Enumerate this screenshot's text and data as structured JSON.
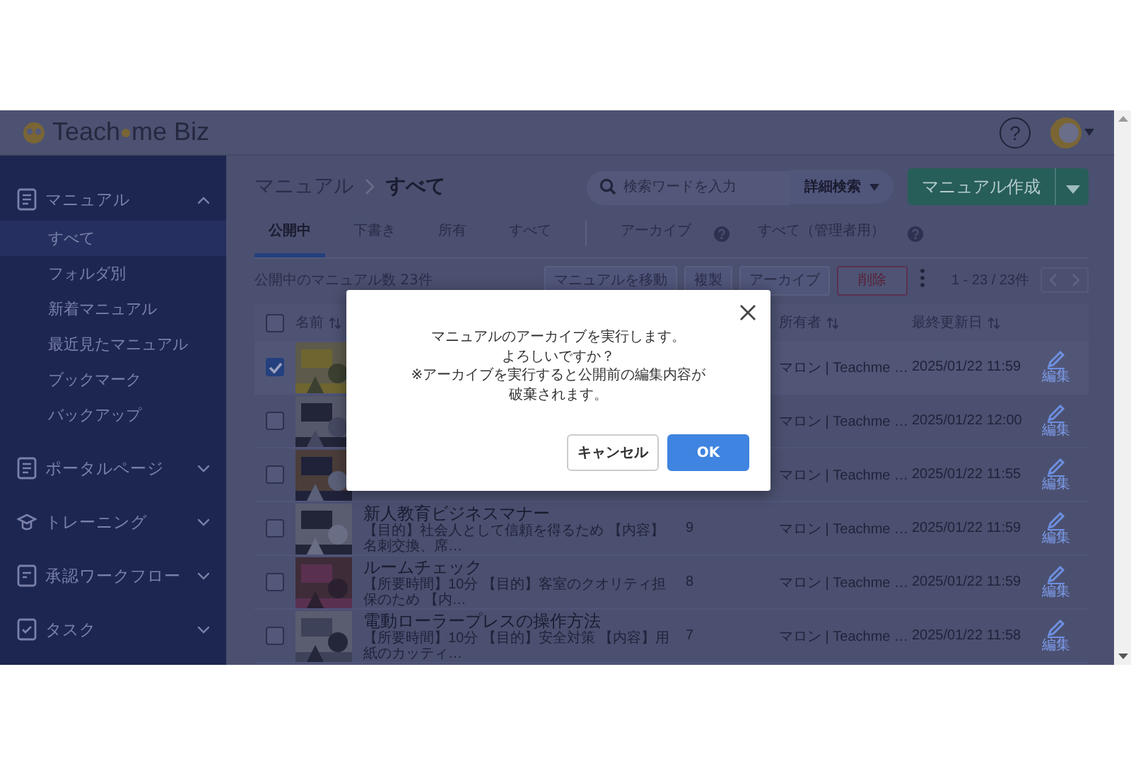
{
  "header": {
    "logo_left": "Teach",
    "logo_right": "me Biz",
    "help": "?"
  },
  "sidebar": {
    "sections": [
      {
        "label": "マニュアル",
        "expanded": true,
        "children": [
          {
            "label": "すべて",
            "selected": true
          },
          {
            "label": "フォルダ別",
            "selected": false
          },
          {
            "label": "新着マニュアル",
            "selected": false
          },
          {
            "label": "最近見たマニュアル",
            "selected": false
          },
          {
            "label": "ブックマーク",
            "selected": false
          },
          {
            "label": "バックアップ",
            "selected": false
          }
        ]
      },
      {
        "label": "ポータルページ",
        "expanded": false
      },
      {
        "label": "トレーニング",
        "expanded": false
      },
      {
        "label": "承認ワークフロー",
        "expanded": false
      },
      {
        "label": "タスク",
        "expanded": false
      }
    ]
  },
  "breadcrumb": [
    "マニュアル",
    "すべて"
  ],
  "search": {
    "placeholder": "検索ワードを入力",
    "advanced": "詳細検索"
  },
  "create_button": "マニュアル作成",
  "tabs": [
    {
      "label": "公開中",
      "selected": true
    },
    {
      "label": "下書き",
      "selected": false
    },
    {
      "label": "所有",
      "selected": false
    },
    {
      "label": "すべて",
      "selected": false
    }
  ],
  "archive_tabs": [
    {
      "label": "アーカイブ",
      "selected": false
    },
    {
      "label": "すべて（管理者用）",
      "selected": false
    }
  ],
  "toolbar": {
    "count": "公開中のマニュアル数 23件",
    "pagination": "1 - 23 / 23件",
    "actions": [
      {
        "label": "マニュアルを移動",
        "kind": "default"
      },
      {
        "label": "複製",
        "kind": "default"
      },
      {
        "label": "アーカイブ",
        "kind": "default"
      },
      {
        "label": "削除",
        "kind": "danger"
      }
    ]
  },
  "table": {
    "all_checked": false,
    "columns": [
      "名前",
      "所有者",
      "最終更新日"
    ],
    "rows": [
      {
        "checked": true,
        "owner": "マロン | Teachme …",
        "updated": "2025/01/22 11:59",
        "edit": "編集"
      },
      {
        "checked": false,
        "owner": "マロン | Teachme …",
        "updated": "2025/01/22 12:00",
        "edit": "編集"
      },
      {
        "checked": false,
        "owner": "マロン | Teachme …",
        "updated": "2025/01/22 11:55",
        "edit": "編集"
      },
      {
        "checked": false,
        "title": "新人教育ビジネスマナー",
        "description": "【目的】社会人として信頼を得るため 【内容】名刺交換、席…",
        "count": "9",
        "owner": "マロン | Teachme …",
        "updated": "2025/01/22 11:59",
        "edit": "編集"
      },
      {
        "checked": false,
        "title": "ルームチェック",
        "description": "【所要時間】10分 【目的】客室のクオリティ担保のため 【内…",
        "count": "8",
        "owner": "マロン | Teachme …",
        "updated": "2025/01/22 11:59",
        "edit": "編集"
      },
      {
        "checked": false,
        "title": "電動ローラープレスの操作方法",
        "description": "【所要時間】10分 【目的】安全対策 【内容】用紙のカッティ…",
        "count": "7",
        "owner": "マロン | Teachme …",
        "updated": "2025/01/22 11:58",
        "edit": "編集"
      }
    ]
  },
  "dialog": {
    "message_lines": [
      "マニュアルのアーカイブを実行します。",
      "よろしいですか？",
      "※アーカイブを実行すると公開前の編集内容が",
      "破棄されます。"
    ],
    "buttons": [
      {
        "label": "キャンセル",
        "kind": "secondary"
      },
      {
        "label": "OK",
        "kind": "primary"
      }
    ]
  }
}
